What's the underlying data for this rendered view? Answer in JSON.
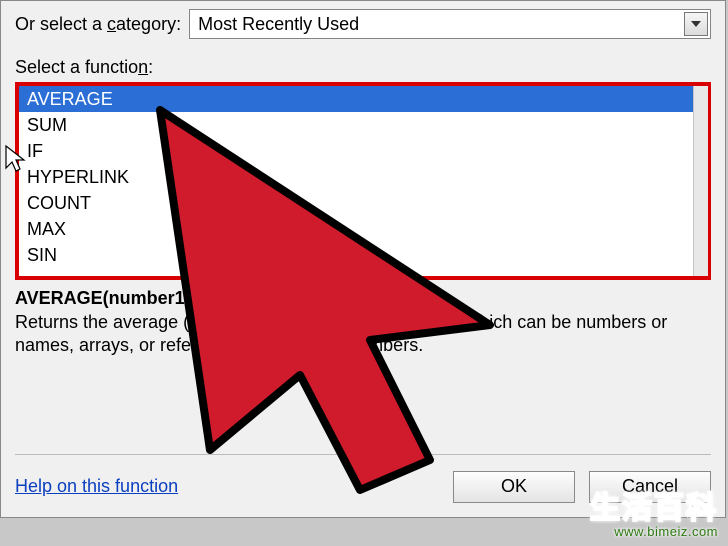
{
  "category": {
    "label_prefix": "Or select a ",
    "label_ul": "c",
    "label_suffix": "ategory:",
    "selected": "Most Recently Used"
  },
  "function_label": {
    "prefix": "Select a functio",
    "ul": "n",
    "suffix": ":"
  },
  "function_list": {
    "items": [
      "AVERAGE",
      "SUM",
      "IF",
      "HYPERLINK",
      "COUNT",
      "MAX",
      "SIN"
    ],
    "selected_index": 0
  },
  "description": {
    "signature": "AVERAGE(number1,number2,...)",
    "text": "Returns the average (arithmetic mean) of its arguments, which can be numbers or names, arrays, or references that contain numbers."
  },
  "footer": {
    "help_link": "Help on this function",
    "ok": "OK",
    "cancel": "Cancel"
  },
  "watermark": {
    "text_main": "生活百",
    "text_gray": "科",
    "url": "www.bimeiz.com"
  }
}
